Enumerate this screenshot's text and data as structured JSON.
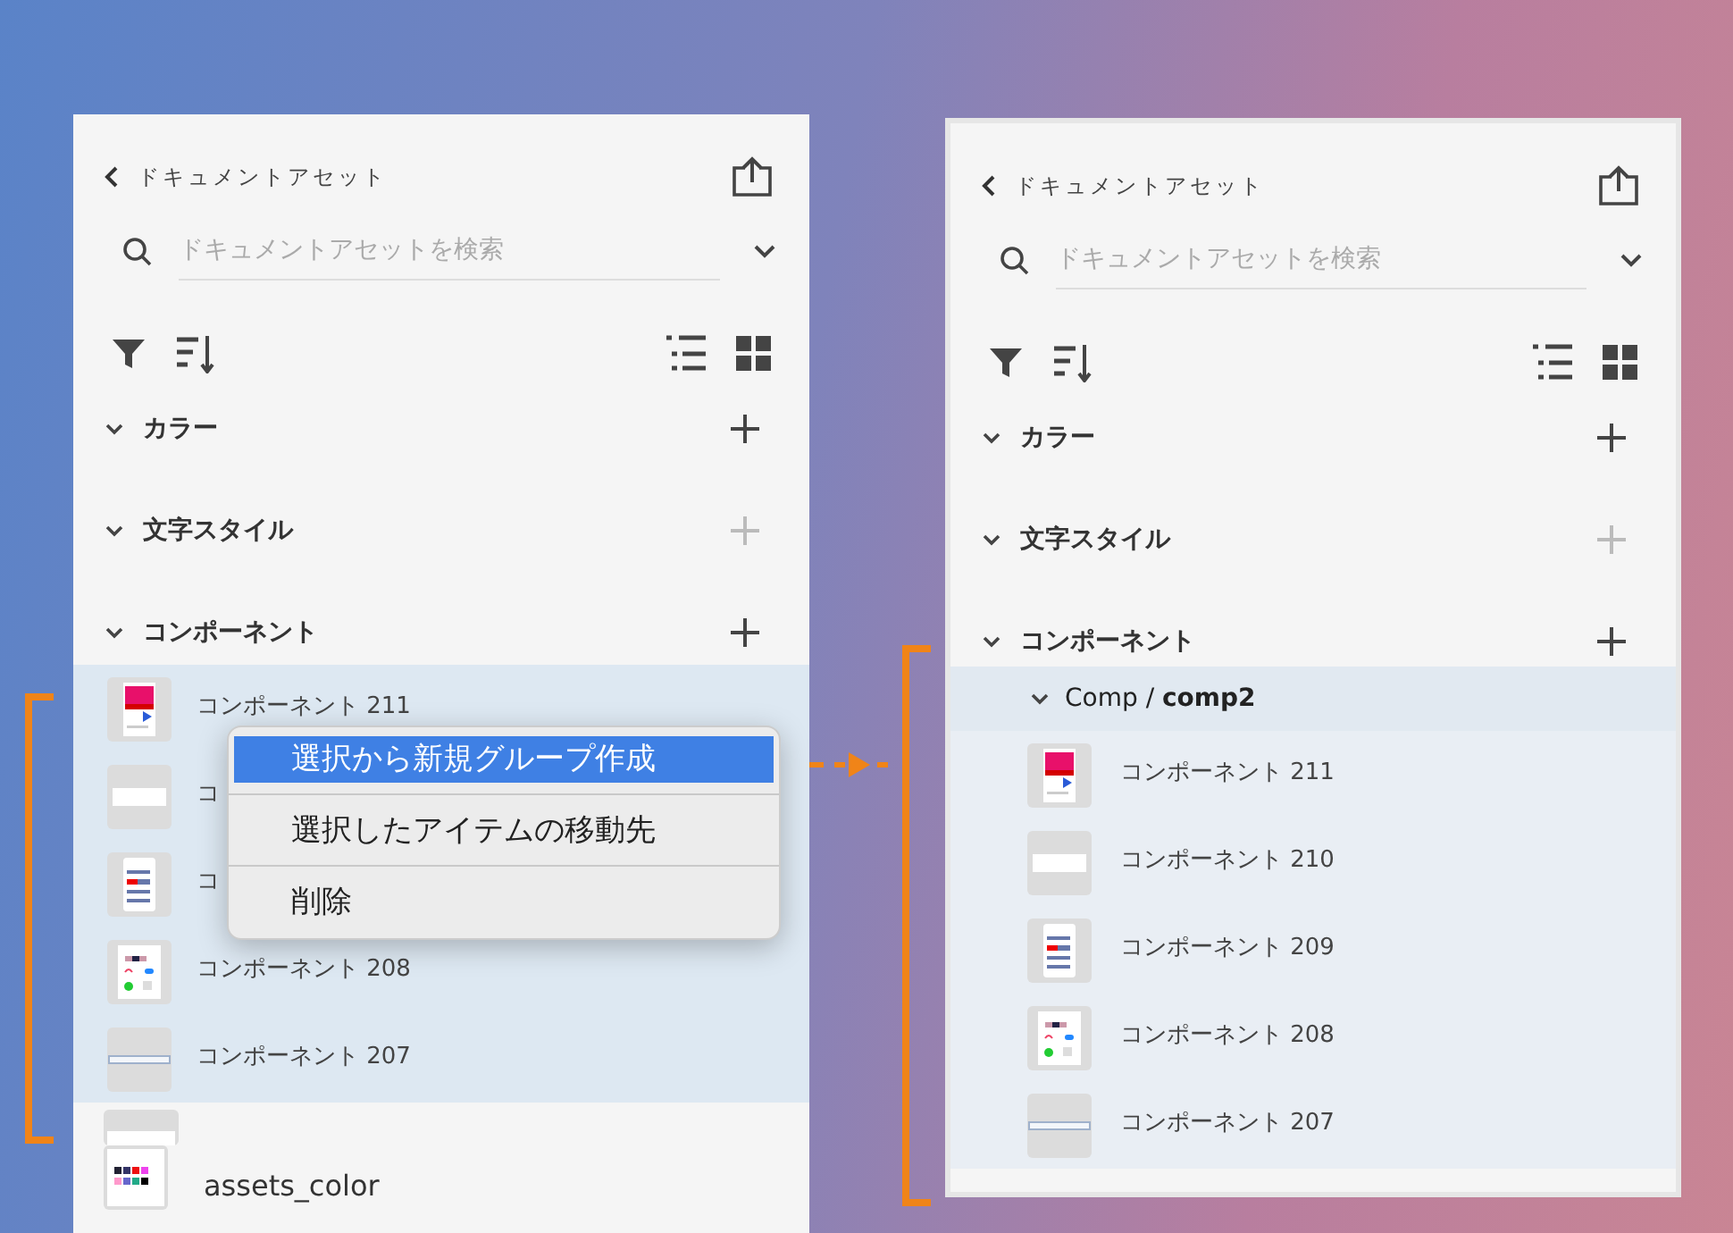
{
  "panels": [
    {
      "back_label": "ドキュメントアセット",
      "search": {
        "placeholder": "ドキュメントアセットを検索"
      },
      "sections": [
        {
          "title": "カラー",
          "expanded": true,
          "add_disabled": false
        },
        {
          "title": "文字スタイル",
          "expanded": true,
          "add_disabled": true
        },
        {
          "title": "コンポーネント",
          "expanded": true,
          "add_disabled": false
        }
      ],
      "items": [
        {
          "kind": "card",
          "label": "コンポーネント 211",
          "selected": true
        },
        {
          "kind": "bar",
          "label": "コ",
          "selected": true
        },
        {
          "kind": "list",
          "label": "コ",
          "selected": true
        },
        {
          "kind": "form",
          "label": "コンポーネント 208",
          "selected": true
        },
        {
          "kind": "line",
          "label": "コンポーネント 207",
          "selected": true
        }
      ],
      "context_menu": [
        {
          "label": "選択から新規グループ作成",
          "selected": true
        },
        {
          "label": "選択したアイテムの移動先",
          "selected": false
        },
        {
          "label": "削除",
          "selected": false
        }
      ],
      "assets": [
        {
          "kind": "swatches",
          "label": "assets_color"
        }
      ]
    },
    {
      "back_label": "ドキュメントアセット",
      "search": {
        "placeholder": "ドキュメントアセットを検索"
      },
      "sections": [
        {
          "title": "カラー",
          "expanded": true,
          "add_disabled": false
        },
        {
          "title": "文字スタイル",
          "expanded": true,
          "add_disabled": true
        },
        {
          "title": "コンポーネント",
          "expanded": true,
          "add_disabled": false
        }
      ],
      "group": {
        "title": "Comp / **comp2**",
        "expanded": true,
        "items": [
          {
            "kind": "card",
            "label": "コンポーネント 211",
            "selected": false
          },
          {
            "kind": "bar",
            "label": "コンポーネント 210",
            "selected": false
          },
          {
            "kind": "list",
            "label": "コンポーネント 209",
            "selected": false
          },
          {
            "kind": "form",
            "label": "コンポーネント 208",
            "selected": false
          },
          {
            "kind": "line",
            "label": "コンポーネント 207",
            "selected": false
          }
        ]
      }
    }
  ]
}
